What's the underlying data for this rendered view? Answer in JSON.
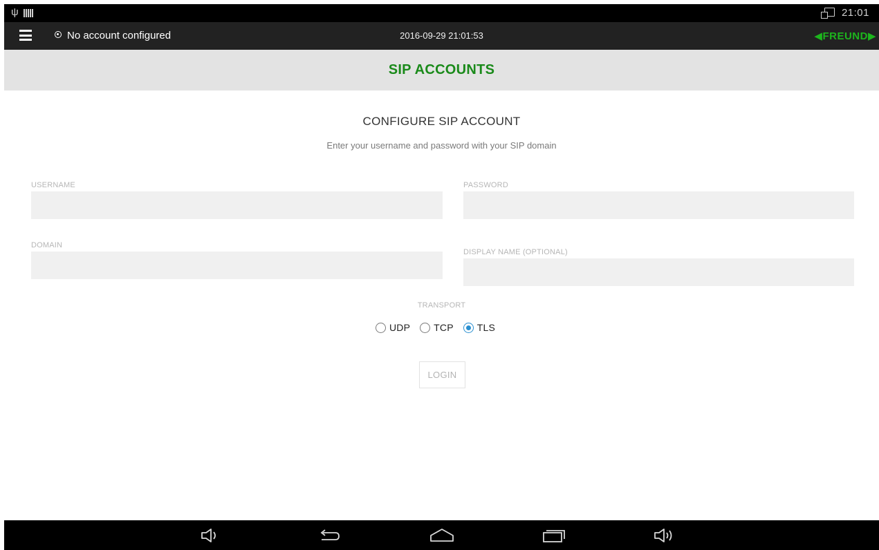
{
  "status_bar": {
    "time": "21:01",
    "icons": [
      "usb-icon",
      "barcode-icon",
      "screen-cast-icon"
    ]
  },
  "app_bar": {
    "menu_icon": "menu-icon",
    "account_status": "No account configured",
    "datetime": "2016-09-29 21:01:53",
    "brand": "◀FREUND▶",
    "brand_color": "#1db51d"
  },
  "title_band": {
    "title": "SIP ACCOUNTS",
    "title_color": "#1a8a1a"
  },
  "form": {
    "heading": "CONFIGURE SIP ACCOUNT",
    "subheading": "Enter your username and password with your SIP domain",
    "username_label": "USERNAME",
    "username_value": "",
    "password_label": "PASSWORD",
    "password_value": "",
    "domain_label": "DOMAIN",
    "domain_value": "",
    "display_name_label": "DISPLAY NAME (OPTIONAL)",
    "display_name_value": "",
    "transport_label": "TRANSPORT",
    "transport_options": [
      "UDP",
      "TCP",
      "TLS"
    ],
    "transport_selected": "TLS",
    "login_label": "LOGIN"
  },
  "nav_bar": {
    "buttons": [
      "volume-down-icon",
      "back-icon",
      "home-icon",
      "recent-apps-icon",
      "volume-up-icon"
    ]
  },
  "colors": {
    "accent": "#2a8fd0",
    "appbar_bg": "#222222",
    "titleband_bg": "#e3e3e3",
    "field_bg": "#f0f0f0"
  }
}
